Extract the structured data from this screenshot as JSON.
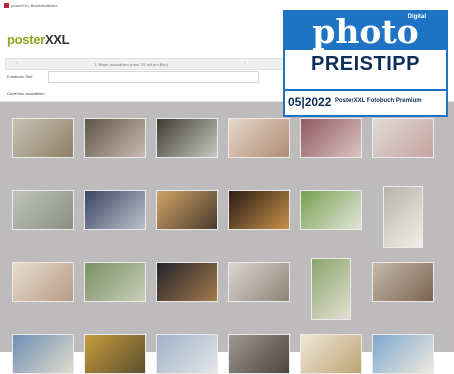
{
  "window": {
    "title": "posterXXL Bestellsoftware"
  },
  "logo": {
    "part1": "poster",
    "part2": "XXL"
  },
  "steps": {
    "current": "1. Bilder auswählen (max. 25 bilt pro Bild)"
  },
  "form": {
    "title_label": "Fotobuch-Titel",
    "title_value": "",
    "cover_label": "Coverfoto auswählen"
  },
  "badge": {
    "digital": "Digital",
    "brand": "photo",
    "award": "PREISTIPP",
    "issue": "05|2022",
    "product": "PosterXXL Fotobuch Premium",
    "color_blue": "#1f73c5",
    "color_navy": "#0c2d56"
  },
  "photos": [
    {
      "name": "photo-couple-meadow",
      "colors": [
        "#c7c1b3",
        "#8e8066"
      ]
    },
    {
      "name": "photo-bride-bouquet",
      "colors": [
        "#5d5646",
        "#cdb9b3"
      ]
    },
    {
      "name": "photo-veiled-bride",
      "colors": [
        "#3d3b36",
        "#c8c8c2"
      ]
    },
    {
      "name": "photo-heart-book",
      "colors": [
        "#e6d7c9",
        "#b08c75"
      ]
    },
    {
      "name": "photo-pink-roses",
      "colors": [
        "#8f5a63",
        "#dcc3bf"
      ]
    },
    {
      "name": "photo-rose-petals",
      "colors": [
        "#e0dbd3",
        "#c6a3a0"
      ]
    },
    {
      "name": "photo-bride-forest",
      "colors": [
        "#c0c3b9",
        "#8b8f82"
      ]
    },
    {
      "name": "photo-couple-dusk",
      "colors": [
        "#3b4662",
        "#bcc0cc"
      ]
    },
    {
      "name": "photo-couple-sunset",
      "colors": [
        "#d0a368",
        "#4a3b2d"
      ]
    },
    {
      "name": "photo-dancing-lights",
      "colors": [
        "#2b1d16",
        "#c79048"
      ]
    },
    {
      "name": "photo-bride-lawn",
      "colors": [
        "#77a050",
        "#e2e5db"
      ]
    },
    {
      "name": "photo-bride-portrait",
      "colors": [
        "#b6b3a8",
        "#f1efe8"
      ]
    },
    {
      "name": "photo-heart-hands",
      "colors": [
        "#e8dccd",
        "#b79b86"
      ]
    },
    {
      "name": "photo-couple-field",
      "colors": [
        "#7a9062",
        "#c9cdb9"
      ]
    },
    {
      "name": "photo-evening-party",
      "colors": [
        "#23232c",
        "#a47a4b"
      ]
    },
    {
      "name": "photo-bride-skirt",
      "colors": [
        "#dad6cf",
        "#8e8477"
      ]
    },
    {
      "name": "photo-couple-garden",
      "colors": [
        "#8aa56c",
        "#e4e0d3"
      ]
    },
    {
      "name": "photo-rings-hands",
      "colors": [
        "#c8b9a9",
        "#7a6350"
      ]
    },
    {
      "name": "photo-couple-beach",
      "colors": [
        "#6f8eb6",
        "#e0dccc"
      ]
    },
    {
      "name": "photo-golden-field",
      "colors": [
        "#c59a3c",
        "#5d5130"
      ]
    },
    {
      "name": "photo-bubbles",
      "colors": [
        "#9fb2c8",
        "#e4e5e8"
      ]
    },
    {
      "name": "photo-archway",
      "colors": [
        "#9f9a8e",
        "#4a463e"
      ]
    },
    {
      "name": "photo-table-decor",
      "colors": [
        "#eee7d7",
        "#bfa474"
      ]
    },
    {
      "name": "photo-beach-dress",
      "colors": [
        "#7da8cf",
        "#eee9dc"
      ]
    }
  ]
}
